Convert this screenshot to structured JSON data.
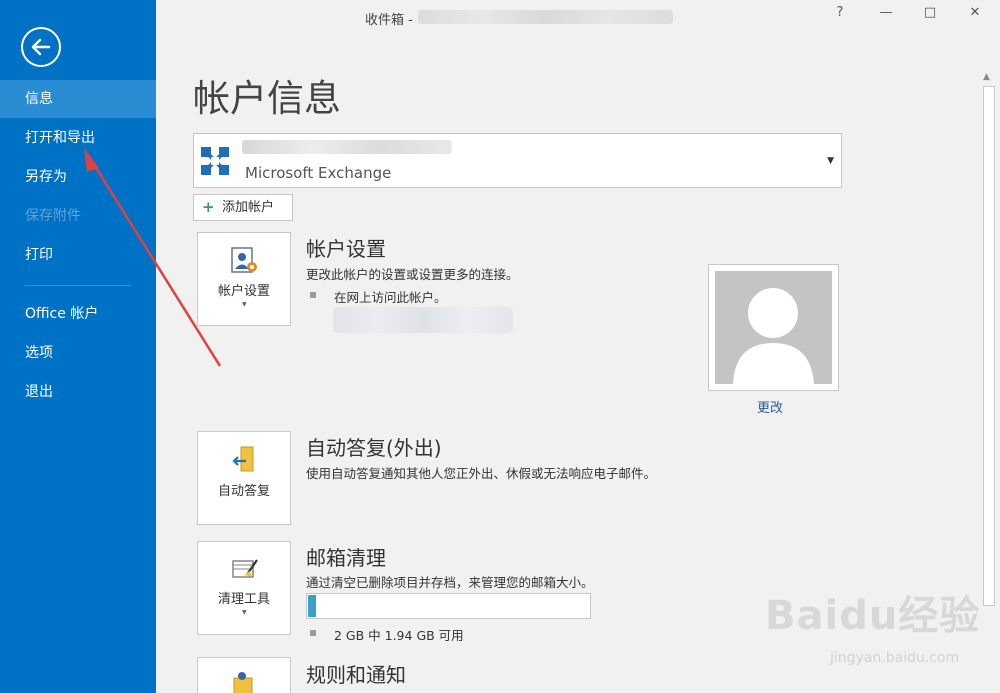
{
  "window": {
    "title": "收件箱 -",
    "buttons": {
      "help": "?",
      "minimize": "—",
      "maximize": "□",
      "close": "✕"
    }
  },
  "sidebar": {
    "back_icon": "arrow-left-icon",
    "items": [
      {
        "label": "信息",
        "active": true
      },
      {
        "label": "打开和导出"
      },
      {
        "label": "另存为"
      },
      {
        "label": "保存附件",
        "disabled": true
      },
      {
        "label": "打印"
      },
      {
        "label": "Office 帐户"
      },
      {
        "label": "选项"
      },
      {
        "label": "退出"
      }
    ]
  },
  "main": {
    "page_title": "帐户信息",
    "account": {
      "type": "Microsoft Exchange"
    },
    "add_account_label": "添加帐户",
    "account_settings": {
      "tile_label": "帐户设置",
      "title": "帐户设置",
      "description": "更改此帐户的设置或设置更多的连接。",
      "bullet": "在网上访问此帐户。",
      "change_link": "更改"
    },
    "auto_reply": {
      "tile_label": "自动答复",
      "title": "自动答复(外出)",
      "description": "使用自动答复通知其他人您正外出、休假或无法响应电子邮件。"
    },
    "mailbox_cleanup": {
      "tile_label": "清理工具",
      "title": "邮箱清理",
      "description": "通过清空已删除项目并存档，来管理您的邮箱大小。",
      "quota_text": "2 GB 中 1.94 GB 可用",
      "used_fraction": 0.03
    },
    "rules": {
      "title": "规则和通知"
    }
  },
  "watermark": {
    "brand": "Baidu经验",
    "url": "jingyan.baidu.com"
  },
  "colors": {
    "sidebar": "#0072c6",
    "sidebar_active": "#2a8dd4",
    "annotation_arrow": "#e04040"
  }
}
